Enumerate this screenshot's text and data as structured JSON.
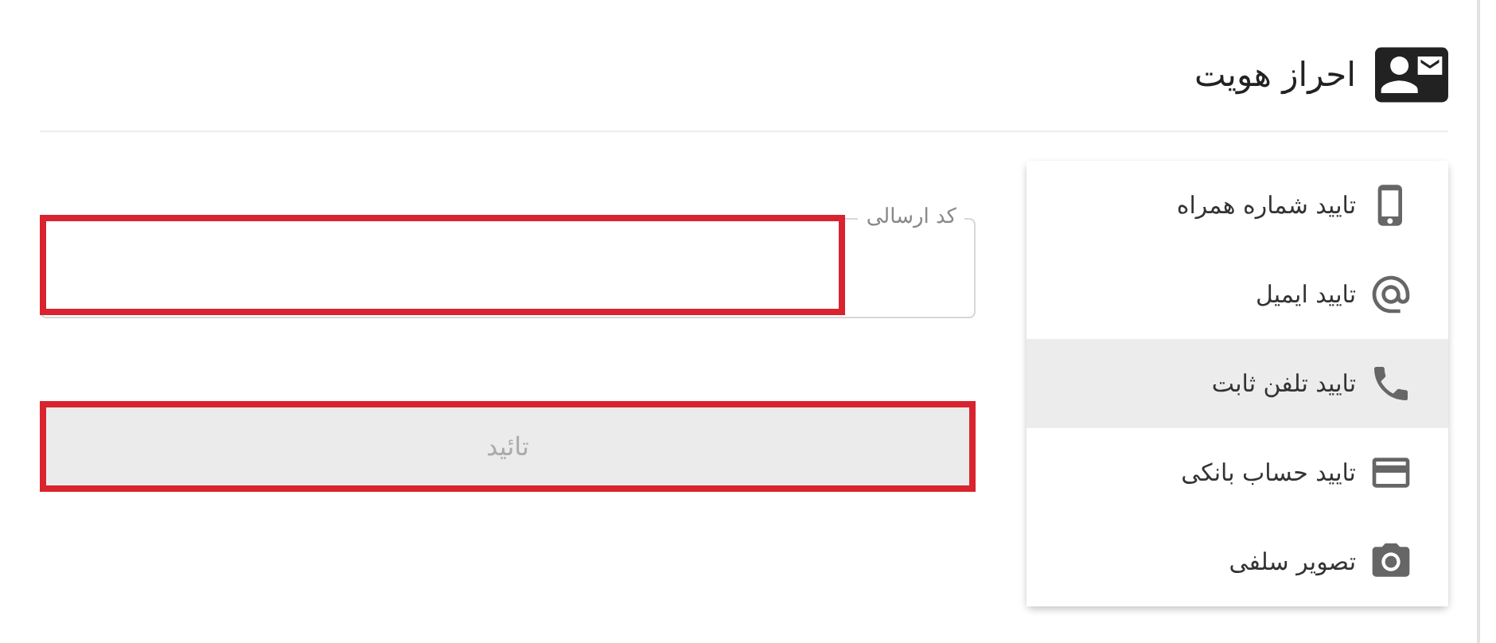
{
  "header": {
    "title": "احراز هویت"
  },
  "menu": [
    {
      "label": "تایید شماره همراه",
      "selected": false
    },
    {
      "label": "تایید ایمیل",
      "selected": false
    },
    {
      "label": "تایید تلفن ثابت",
      "selected": true
    },
    {
      "label": "تایید حساب بانکی",
      "selected": false
    },
    {
      "label": "تصویر سلفی",
      "selected": false
    }
  ],
  "code_field": {
    "label": "کد ارسالی",
    "highlighted": true
  },
  "submit_button": {
    "label": "تائید",
    "disabled": true,
    "highlighted": true
  }
}
